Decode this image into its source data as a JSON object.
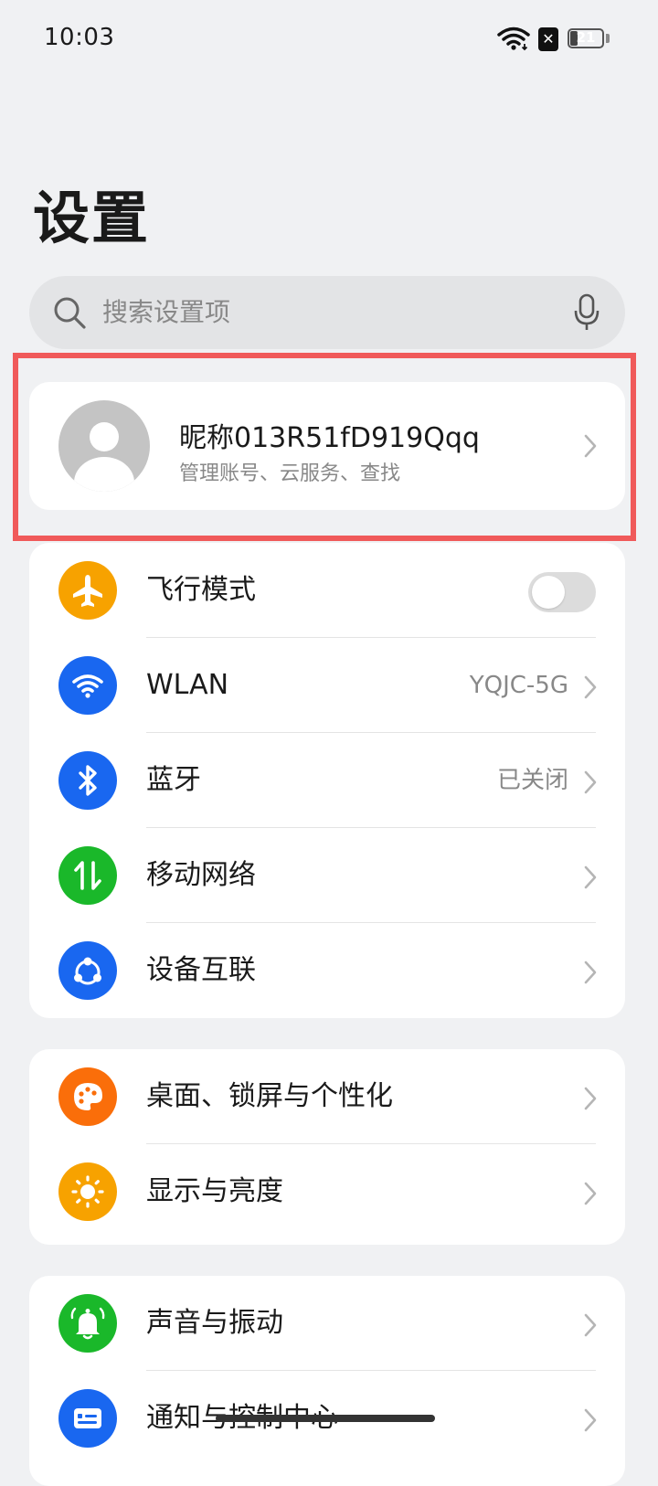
{
  "status": {
    "time": "10:03",
    "battery": "21",
    "sim": "✕"
  },
  "page": {
    "title": "设置"
  },
  "search": {
    "placeholder": "搜索设置项"
  },
  "profile": {
    "name": "昵称013R51fD919Qqq",
    "subtitle": "管理账号、云服务、查找"
  },
  "group1": [
    {
      "label": "飞行模式",
      "icon": "airplane-icon",
      "color": "#f7a200",
      "toggle": "off"
    },
    {
      "label": "WLAN",
      "value": "YQJC-5G",
      "icon": "wifi-icon",
      "color": "#1967f0"
    },
    {
      "label": "蓝牙",
      "value": "已关闭",
      "icon": "bluetooth-icon",
      "color": "#1967f0"
    },
    {
      "label": "移动网络",
      "icon": "mobile-data-icon",
      "color": "#1ab82a"
    },
    {
      "label": "设备互联",
      "icon": "device-connect-icon",
      "color": "#1967f0"
    }
  ],
  "group2": [
    {
      "label": "桌面、锁屏与个性化",
      "icon": "palette-icon",
      "color": "#fa6e0a"
    },
    {
      "label": "显示与亮度",
      "icon": "brightness-icon",
      "color": "#f7a200"
    }
  ],
  "group3": [
    {
      "label": "声音与振动",
      "icon": "bell-icon",
      "color": "#1ab82a"
    },
    {
      "label": "通知与控制中心",
      "icon": "notification-icon",
      "color": "#1967f0"
    }
  ]
}
